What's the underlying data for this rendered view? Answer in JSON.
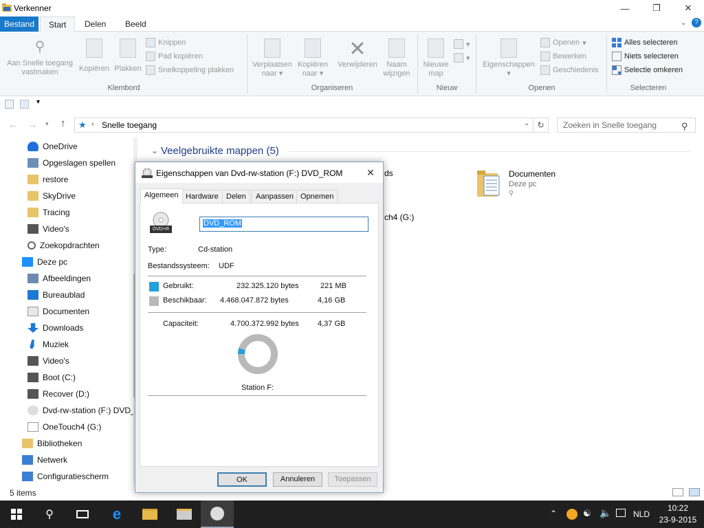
{
  "window": {
    "title": "Verkenner"
  },
  "ribbon_tabs": [
    "Bestand",
    "Start",
    "Delen",
    "Beeld"
  ],
  "ribbon": {
    "pin_label": [
      "Aan Snelle toegang",
      "vastmaken"
    ],
    "copy_label": "Kopiëren",
    "paste_label": "Plakken",
    "cut_label": "Knippen",
    "copy_path_label": "Pad kopiëren",
    "paste_shortcut_label": "Snelkoppeling plakken",
    "clipboard_group": "Klembord",
    "move_label": [
      "Verplaatsen",
      "naar"
    ],
    "copyto_label": [
      "Kopiëren",
      "naar"
    ],
    "delete_label": "Verwijderen",
    "rename_label": [
      "Naam",
      "wijzigen"
    ],
    "organize_group": "Organiseren",
    "newfolder_label": [
      "Nieuwe",
      "map"
    ],
    "new_group": "Nieuw",
    "properties_label": "Eigenschappen",
    "open_label": "Openen",
    "edit_label": "Bewerken",
    "history_label": "Geschiedenis",
    "open_group": "Openen",
    "select_all_label": "Alles selecteren",
    "select_none_label": "Niets selecteren",
    "invert_label": "Selectie omkeren",
    "select_group": "Selecteren"
  },
  "address": {
    "crumb": "Snelle toegang",
    "search_placeholder": "Zoeken in Snelle toegang"
  },
  "nav_items": [
    {
      "label": "OneDrive",
      "indent": 1
    },
    {
      "label": "Opgeslagen spellen",
      "indent": 1
    },
    {
      "label": "restore",
      "indent": 1
    },
    {
      "label": "SkyDrive",
      "indent": 1
    },
    {
      "label": "Tracing",
      "indent": 1
    },
    {
      "label": "Video's",
      "indent": 1
    },
    {
      "label": "Zoekopdrachten",
      "indent": 1
    },
    {
      "label": "Deze pc",
      "indent": 0
    },
    {
      "label": "Afbeeldingen",
      "indent": 1
    },
    {
      "label": "Bureaublad",
      "indent": 1
    },
    {
      "label": "Documenten",
      "indent": 1
    },
    {
      "label": "Downloads",
      "indent": 1
    },
    {
      "label": "Muziek",
      "indent": 1
    },
    {
      "label": "Video's",
      "indent": 1
    },
    {
      "label": "Boot (C:)",
      "indent": 1
    },
    {
      "label": "Recover (D:)",
      "indent": 1
    },
    {
      "label": "Dvd-rw-station (F:) DVD_",
      "indent": 1
    },
    {
      "label": "OneTouch4 (G:)",
      "indent": 1
    },
    {
      "label": "Bibliotheken",
      "indent": 0
    },
    {
      "label": "Netwerk",
      "indent": 0
    },
    {
      "label": "Configuratiescherm",
      "indent": 0
    }
  ],
  "content": {
    "section_title": "Veelgebruikte mappen (5)",
    "partial1": "ds",
    "partial2": "ch4 (G:)",
    "doc_name": "Documenten",
    "doc_sub": "Deze pc"
  },
  "status": {
    "items": "5 items"
  },
  "dialog": {
    "title": "Eigenschappen van Dvd-rw-station (F:) DVD_ROM",
    "tabs": [
      "Algemeen",
      "Hardware",
      "Delen",
      "Aanpassen",
      "Opnemen"
    ],
    "name_value": "DVD_ROM",
    "drive_icon_text": "DVD+R",
    "type_label": "Type:",
    "type_value": "Cd-station",
    "fs_label": "Bestandssysteem:",
    "fs_value": "UDF",
    "used_label": "Gebruikt:",
    "used_bytes": "232.325.120 bytes",
    "used_h": "221 MB",
    "free_label": "Beschikbaar:",
    "free_bytes": "4.468.047.872 bytes",
    "free_h": "4,16 GB",
    "cap_label": "Capaciteit:",
    "cap_bytes": "4.700.372.992 bytes",
    "cap_h": "4,37 GB",
    "station_label": "Station F:",
    "used_fraction": 0.0494,
    "used_color": "#26a0da",
    "free_color": "#b9b9b9",
    "ok": "OK",
    "cancel": "Annuleren",
    "apply": "Toepassen"
  },
  "taskbar": {
    "lang": "NLD",
    "time": "10:22",
    "date": "23-9-2015"
  }
}
